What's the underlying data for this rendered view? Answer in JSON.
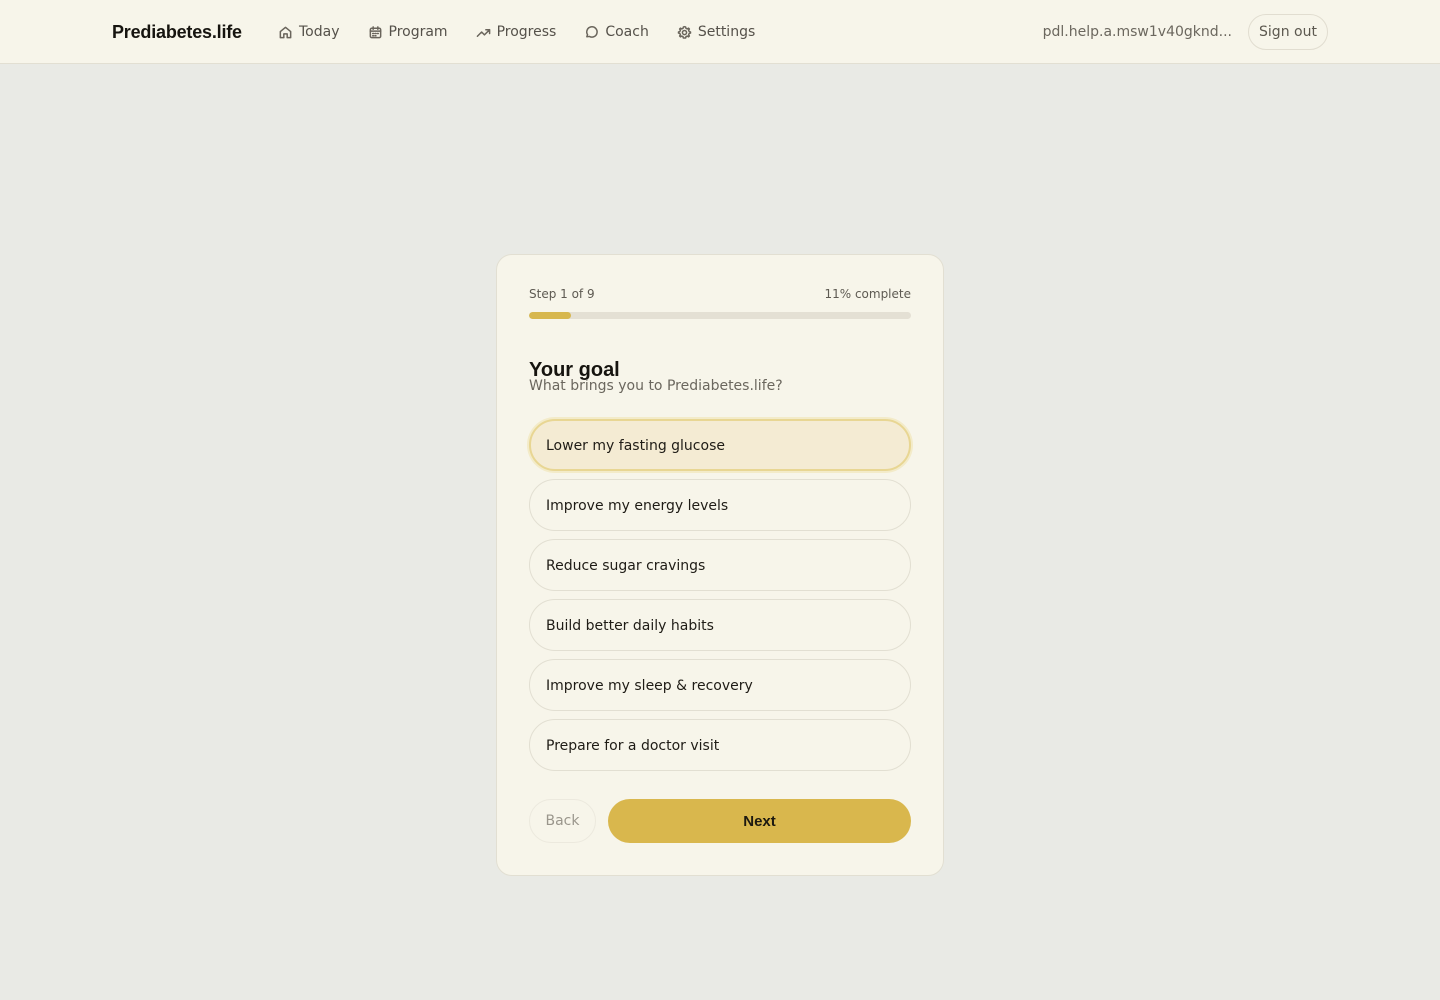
{
  "header": {
    "brand": "Prediabetes.life",
    "nav": [
      {
        "label": "Today",
        "icon": "home-icon"
      },
      {
        "label": "Program",
        "icon": "calendar-icon"
      },
      {
        "label": "Progress",
        "icon": "trend-up-icon"
      },
      {
        "label": "Coach",
        "icon": "chat-bubble-icon"
      },
      {
        "label": "Settings",
        "icon": "gear-icon"
      }
    ],
    "user_email": "pdl.help.a.msw1v40gknd...",
    "sign_out_label": "Sign out"
  },
  "onboarding": {
    "step_label": "Step 1 of 9",
    "percent_label": "11% complete",
    "progress_fraction": 0.11,
    "title": "Your goal",
    "subtitle": "What brings you to Prediabetes.life?",
    "options": [
      {
        "label": "Lower my fasting glucose",
        "selected": true
      },
      {
        "label": "Improve my energy levels",
        "selected": false
      },
      {
        "label": "Reduce sugar cravings",
        "selected": false
      },
      {
        "label": "Build better daily habits",
        "selected": false
      },
      {
        "label": "Improve my sleep & recovery",
        "selected": false
      },
      {
        "label": "Prepare for a doctor visit",
        "selected": false
      }
    ],
    "back_label": "Back",
    "next_label": "Next"
  },
  "colors": {
    "accent": "#d9b74d",
    "background": "#e9eae5",
    "surface": "#f7f5ea",
    "selected_option": "#f4ebd3"
  }
}
